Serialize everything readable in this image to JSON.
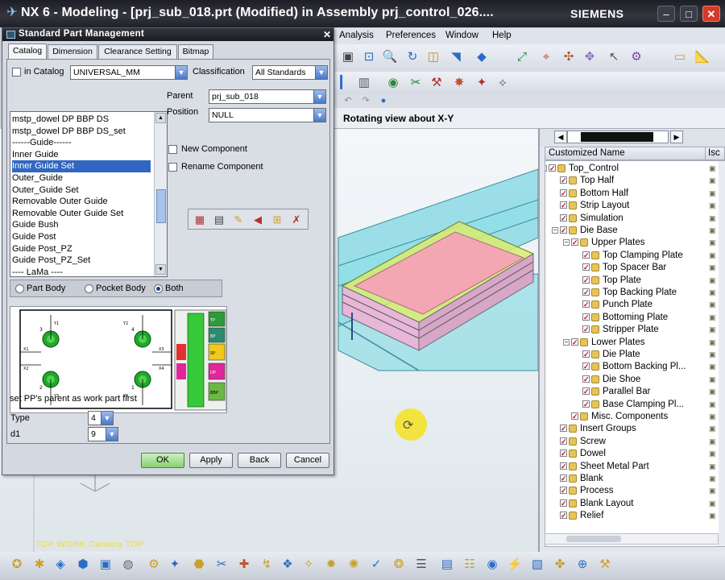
{
  "window": {
    "title": "NX 6 - Modeling - [prj_sub_018.prt (Modified)  in Assembly prj_control_026....",
    "brand": "SIEMENS"
  },
  "menubar": [
    "Analysis",
    "Preferences",
    "Window",
    "Help"
  ],
  "status": {
    "text": "Rotating view about X-Y"
  },
  "graphics": {
    "work_view_label": "TOP WORK Camera TOP"
  },
  "navigator": {
    "columns": [
      "Customized Name",
      "Isc"
    ],
    "items": [
      {
        "label": "Top_Control",
        "level": 0,
        "expander": "minus"
      },
      {
        "label": "Top Half",
        "level": 1
      },
      {
        "label": "Bottom Half",
        "level": 1
      },
      {
        "label": "Strip Layout",
        "level": 1
      },
      {
        "label": "Simulation",
        "level": 1
      },
      {
        "label": "Die Base",
        "level": 1,
        "expander": "minus"
      },
      {
        "label": "Upper Plates",
        "level": 2,
        "expander": "minus"
      },
      {
        "label": "Top Clamping Plate",
        "level": 3
      },
      {
        "label": "Top Spacer Bar",
        "level": 3
      },
      {
        "label": "Top Plate",
        "level": 3
      },
      {
        "label": "Top Backing Plate",
        "level": 3
      },
      {
        "label": "Punch Plate",
        "level": 3
      },
      {
        "label": "Bottoming Plate",
        "level": 3
      },
      {
        "label": "Stripper Plate",
        "level": 3
      },
      {
        "label": "Lower Plates",
        "level": 2,
        "expander": "minus"
      },
      {
        "label": "Die Plate",
        "level": 3
      },
      {
        "label": "Bottom Backing Pl...",
        "level": 3
      },
      {
        "label": "Die Shoe",
        "level": 3
      },
      {
        "label": "Parallel Bar",
        "level": 3
      },
      {
        "label": "Base Clamping Pl...",
        "level": 3
      },
      {
        "label": "Misc. Components",
        "level": 2
      },
      {
        "label": "Insert Groups",
        "level": 1
      },
      {
        "label": "Screw",
        "level": 1
      },
      {
        "label": "Dowel",
        "level": 1
      },
      {
        "label": "Sheet Metal Part",
        "level": 1
      },
      {
        "label": "Blank",
        "level": 1
      },
      {
        "label": "Process",
        "level": 1
      },
      {
        "label": "Blank Layout",
        "level": 1
      },
      {
        "label": "Relief",
        "level": 1
      }
    ]
  },
  "dialog": {
    "title": "Standard Part Management",
    "tabs": [
      "Catalog",
      "Dimension",
      "Clearance Setting",
      "Bitmap"
    ],
    "in_catalog_label": "in Catalog",
    "catalog_value": "UNIVERSAL_MM",
    "classification_label": "Classification",
    "classification_value": "All Standards",
    "parent_label": "Parent",
    "parent_value": "prj_sub_018",
    "position_label": "Position",
    "position_value": "NULL",
    "list_items": [
      "mstp_dowel DP BBP DS",
      "mstp_dowel DP BBP DS_set",
      "------Guide------",
      "Inner Guide",
      "Inner Guide Set",
      "Outer_Guide",
      "Outer_Guide Set",
      "Removable Outer Guide",
      "Removable Outer Guide Set",
      "Guide Bush",
      "Guide Post",
      "Guide Post_PZ",
      "Guide Post_PZ_Set",
      "---- LaMa ----"
    ],
    "selected_item": "Inner Guide Set",
    "new_component_label": "New Component",
    "rename_component_label": "Rename Component",
    "radios": [
      "Part Body",
      "Pocket Body",
      "Both"
    ],
    "radio_selected": "Both",
    "hint": "set PP's parent as work part first",
    "type_label": "Type",
    "type_value": "4",
    "d1_label": "d1",
    "d1_value": "9",
    "buttons": {
      "ok": "OK",
      "apply": "Apply",
      "back": "Back",
      "cancel": "Cancel"
    },
    "bitmap_labels": {
      "corner1": "1",
      "corner2": "2",
      "corner3": "3",
      "corner4": "4",
      "y1": "Y1",
      "y2": "Y2",
      "y3": "Y3",
      "y4": "Y4",
      "x1": "X1",
      "x2": "X2",
      "x3": "X3",
      "x4": "X4",
      "side": [
        "TP",
        "BP",
        "SP",
        "DP",
        "BBP"
      ]
    }
  },
  "colors": {
    "accent": "#3167c2",
    "ok": "#88d070",
    "close": "#d43a28",
    "selection": "#3167c2"
  }
}
